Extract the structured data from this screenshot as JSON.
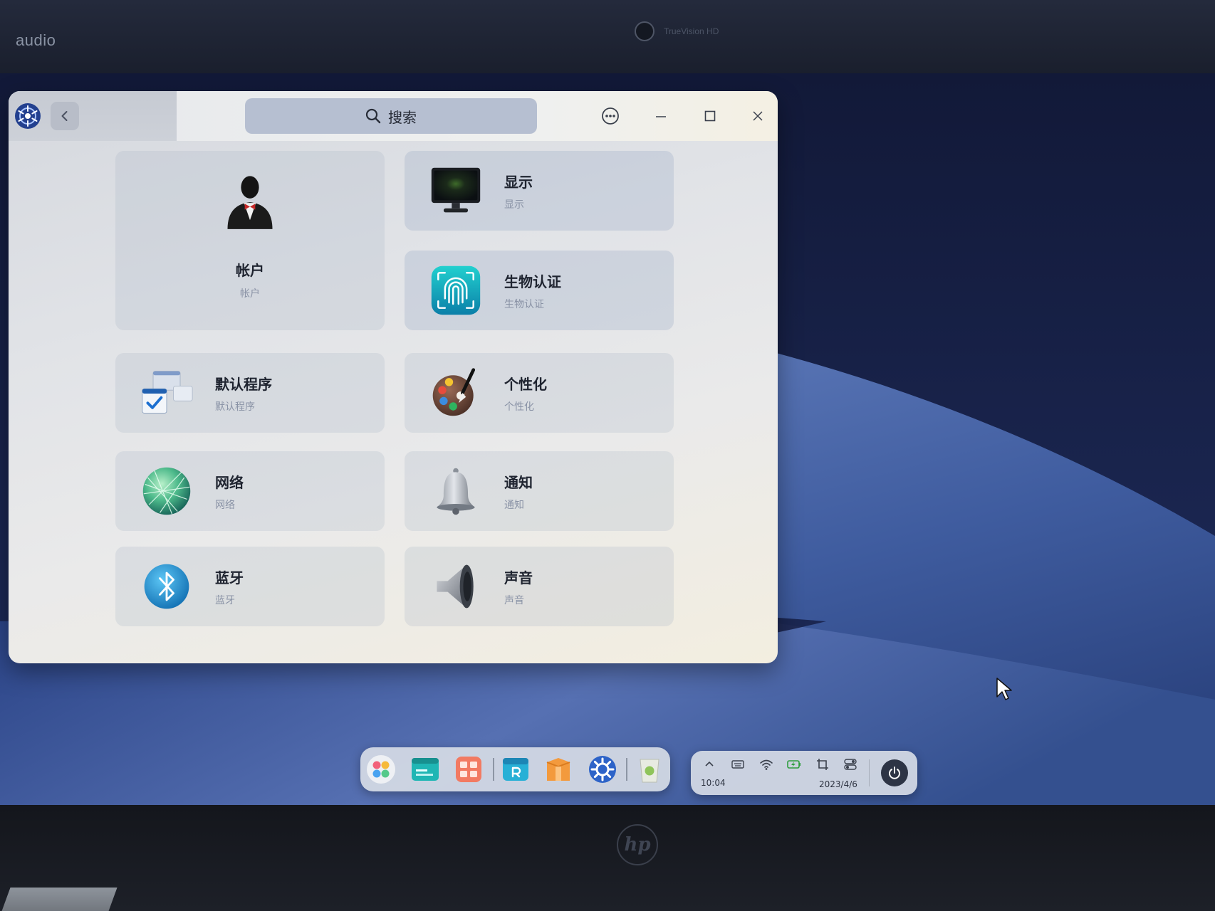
{
  "bezel": {
    "brand_label": "audio",
    "camera_label": "TrueVision HD",
    "logo_text": "hp",
    "camera_icon": "webcam-icon"
  },
  "window": {
    "app_icon": "deepin-logo-icon",
    "back_icon": "chevron-left-icon",
    "search": {
      "icon": "search-icon",
      "placeholder": "搜索"
    },
    "controls": [
      "more-menu-icon",
      "minimize-icon",
      "maximize-icon",
      "close-icon"
    ],
    "modules": [
      {
        "title": "帐户",
        "subtitle": "帐户",
        "icon": "user-icon"
      },
      {
        "title": "显示",
        "subtitle": "显示",
        "icon": "monitor-icon"
      },
      {
        "title": "生物认证",
        "subtitle": "生物认证",
        "icon": "fingerprint-icon"
      },
      {
        "title": "默认程序",
        "subtitle": "默认程序",
        "icon": "default-apps-icon"
      },
      {
        "title": "个性化",
        "subtitle": "个性化",
        "icon": "palette-icon"
      },
      {
        "title": "网络",
        "subtitle": "网络",
        "icon": "globe-icon"
      },
      {
        "title": "通知",
        "subtitle": "通知",
        "icon": "bell-icon"
      },
      {
        "title": "蓝牙",
        "subtitle": "蓝牙",
        "icon": "bluetooth-icon"
      },
      {
        "title": "声音",
        "subtitle": "声音",
        "icon": "speaker-icon"
      }
    ]
  },
  "dock": {
    "apps": [
      "launcher-icon",
      "file-manager-icon",
      "app-grid-icon",
      "app-store-icon",
      "archive-icon",
      "settings-gear-icon",
      "trash-icon"
    ]
  },
  "tray": {
    "icons": [
      "chevron-up-icon",
      "keyboard-icon",
      "wifi-icon",
      "battery-icon",
      "screenshot-icon",
      "toggle-icon"
    ],
    "time": "10:04",
    "date": "2023/4/6",
    "power_icon": "power-icon"
  },
  "colors": {
    "desktop": "#1c2a5a",
    "window_bg": "#e3e5e9",
    "search_bg": "#b6bfd1",
    "title_text": "#1f2430",
    "subtitle_text": "#8a93a6",
    "dock_bg": "#d6dbe5"
  }
}
